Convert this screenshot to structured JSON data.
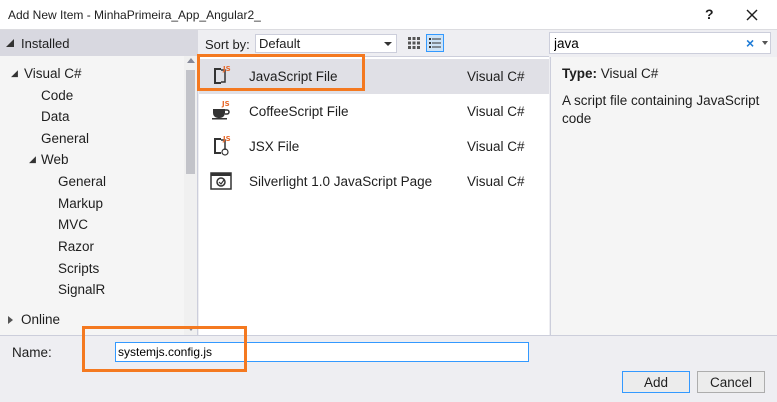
{
  "window": {
    "title": "Add New Item - MinhaPrimeira_App_Angular2_",
    "help_label": "?"
  },
  "tree": {
    "installed_label": "Installed",
    "online_label": "Online",
    "items": [
      {
        "label": "Visual C#",
        "level": 0,
        "expanded": true
      },
      {
        "label": "Code",
        "level": 1
      },
      {
        "label": "Data",
        "level": 1
      },
      {
        "label": "General",
        "level": 1
      },
      {
        "label": "Web",
        "level": 1,
        "expanded": true
      },
      {
        "label": "General",
        "level": 2
      },
      {
        "label": "Markup",
        "level": 2
      },
      {
        "label": "MVC",
        "level": 2
      },
      {
        "label": "Razor",
        "level": 2
      },
      {
        "label": "Scripts",
        "level": 2
      },
      {
        "label": "SignalR",
        "level": 2
      }
    ]
  },
  "toolbar": {
    "sort_label": "Sort by:",
    "sort_value": "Default"
  },
  "search": {
    "value": "java",
    "clear_label": "×"
  },
  "templates": [
    {
      "name": "JavaScript File",
      "type": "Visual C#",
      "icon": "javascript-file-icon",
      "selected": true
    },
    {
      "name": "CoffeeScript File",
      "type": "Visual C#",
      "icon": "coffeescript-file-icon"
    },
    {
      "name": "JSX File",
      "type": "Visual C#",
      "icon": "jsx-file-icon"
    },
    {
      "name": "Silverlight 1.0 JavaScript Page",
      "type": "Visual C#",
      "icon": "silverlight-page-icon"
    }
  ],
  "details": {
    "type_label": "Type:",
    "type_value": "Visual C#",
    "description": "A script file containing JavaScript code"
  },
  "name_field": {
    "label": "Name:",
    "value": "systemjs.config.js"
  },
  "buttons": {
    "add_label": "Add",
    "cancel_label": "Cancel"
  },
  "colors": {
    "accent": "#3399ff",
    "highlight": "#f47920",
    "js_badge": "#e8682a"
  }
}
